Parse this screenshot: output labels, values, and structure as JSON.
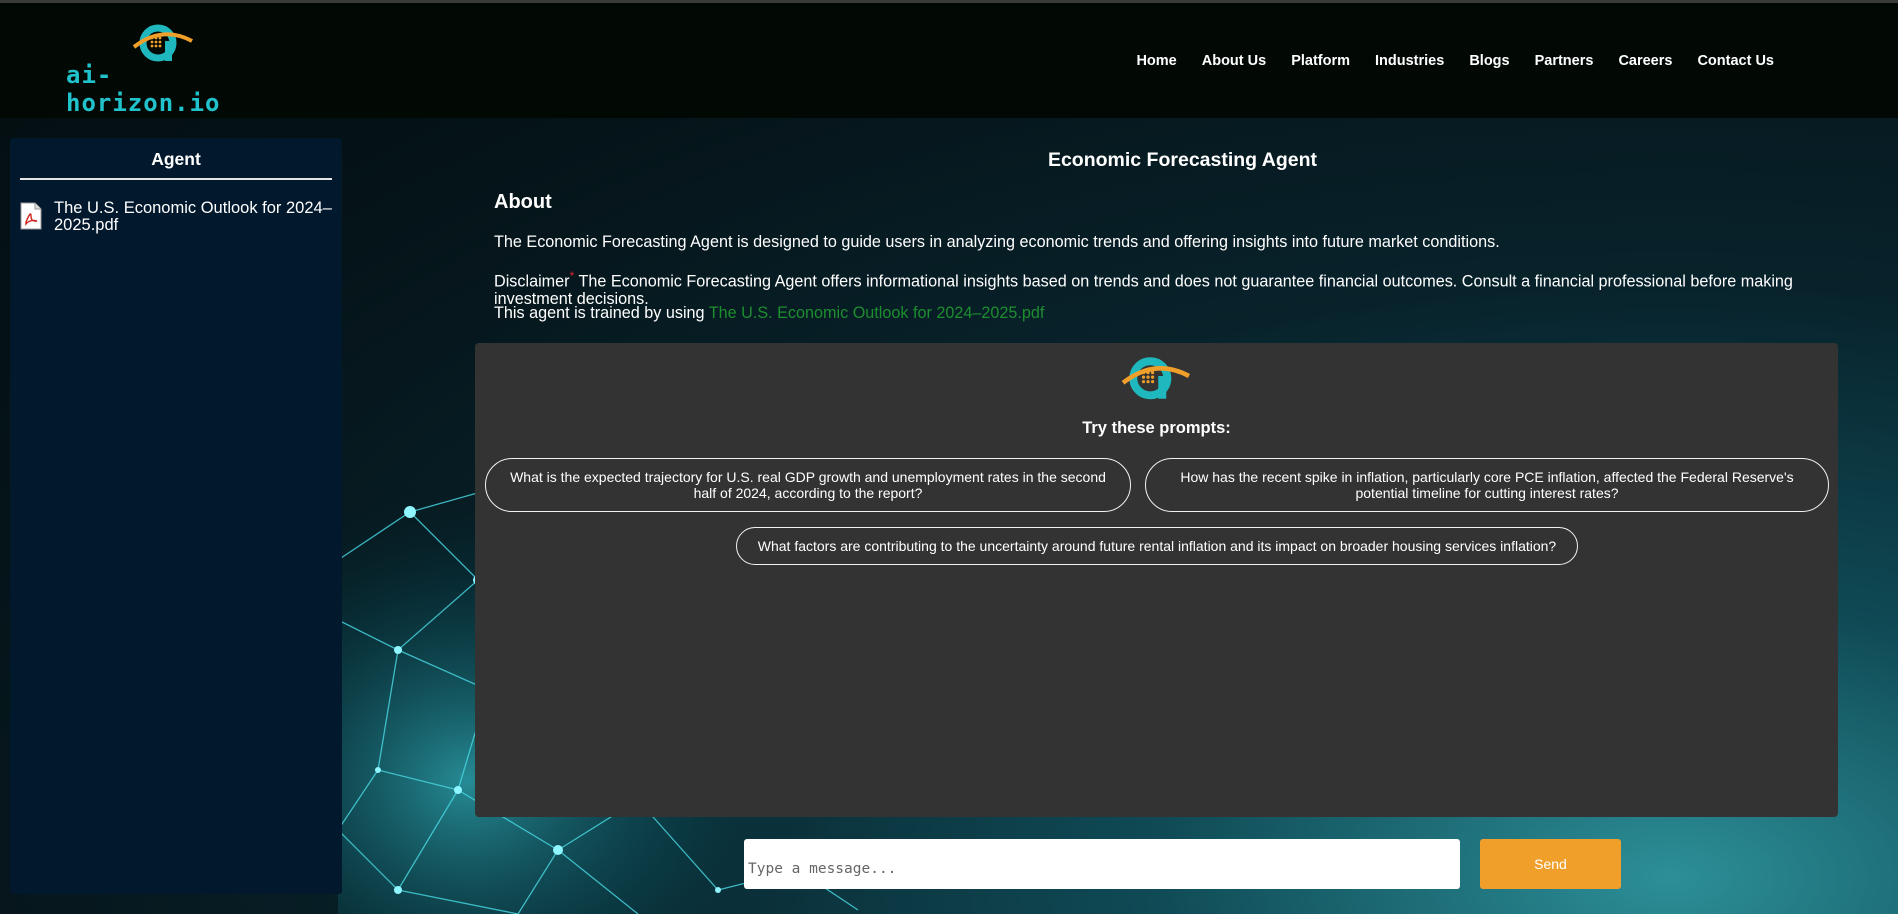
{
  "brand": {
    "logo_text": "ai-horizon.io"
  },
  "nav": {
    "items": [
      {
        "label": "Home"
      },
      {
        "label": "About Us"
      },
      {
        "label": "Platform"
      },
      {
        "label": "Industries"
      },
      {
        "label": "Blogs"
      },
      {
        "label": "Partners"
      },
      {
        "label": "Careers"
      },
      {
        "label": "Contact Us"
      }
    ]
  },
  "sidebar": {
    "title": "Agent",
    "documents": [
      {
        "name": "The U.S. Economic Outlook for 2024–2025.pdf",
        "icon": "pdf-file-icon"
      }
    ]
  },
  "main": {
    "title": "Economic Forecasting Agent",
    "about_heading": "About",
    "about_text": "The Economic Forecasting Agent is designed to guide users in analyzing economic trends and offering insights into future market conditions.",
    "disclaimer_label": "Disclaimer",
    "disclaimer_text": " The Economic Forecasting Agent offers informational insights based on trends and does not guarantee financial outcomes. Consult a financial professional before making investment decisions.",
    "trained_prefix": "This agent is trained by using ",
    "trained_link": "The U.S. Economic Outlook for 2024–2025.pdf"
  },
  "chat": {
    "prompts_heading": "Try these prompts:",
    "prompts": [
      "What is the expected trajectory for U.S. real GDP growth and unemployment rates in the second half of 2024, according to the report?",
      "How has the recent spike in inflation, particularly core PCE inflation, affected the Federal Reserve's potential timeline for cutting interest rates?",
      "What factors are contributing to the uncertainty around future rental inflation and its impact on broader housing services inflation?"
    ],
    "input_placeholder": "Type a message...",
    "send_label": "Send"
  },
  "colors": {
    "accent": "#f0a02a",
    "brand_teal": "#20c3cc",
    "link_green": "#1d8e2f",
    "panel": "#333333",
    "sidebar": "#02182c"
  }
}
